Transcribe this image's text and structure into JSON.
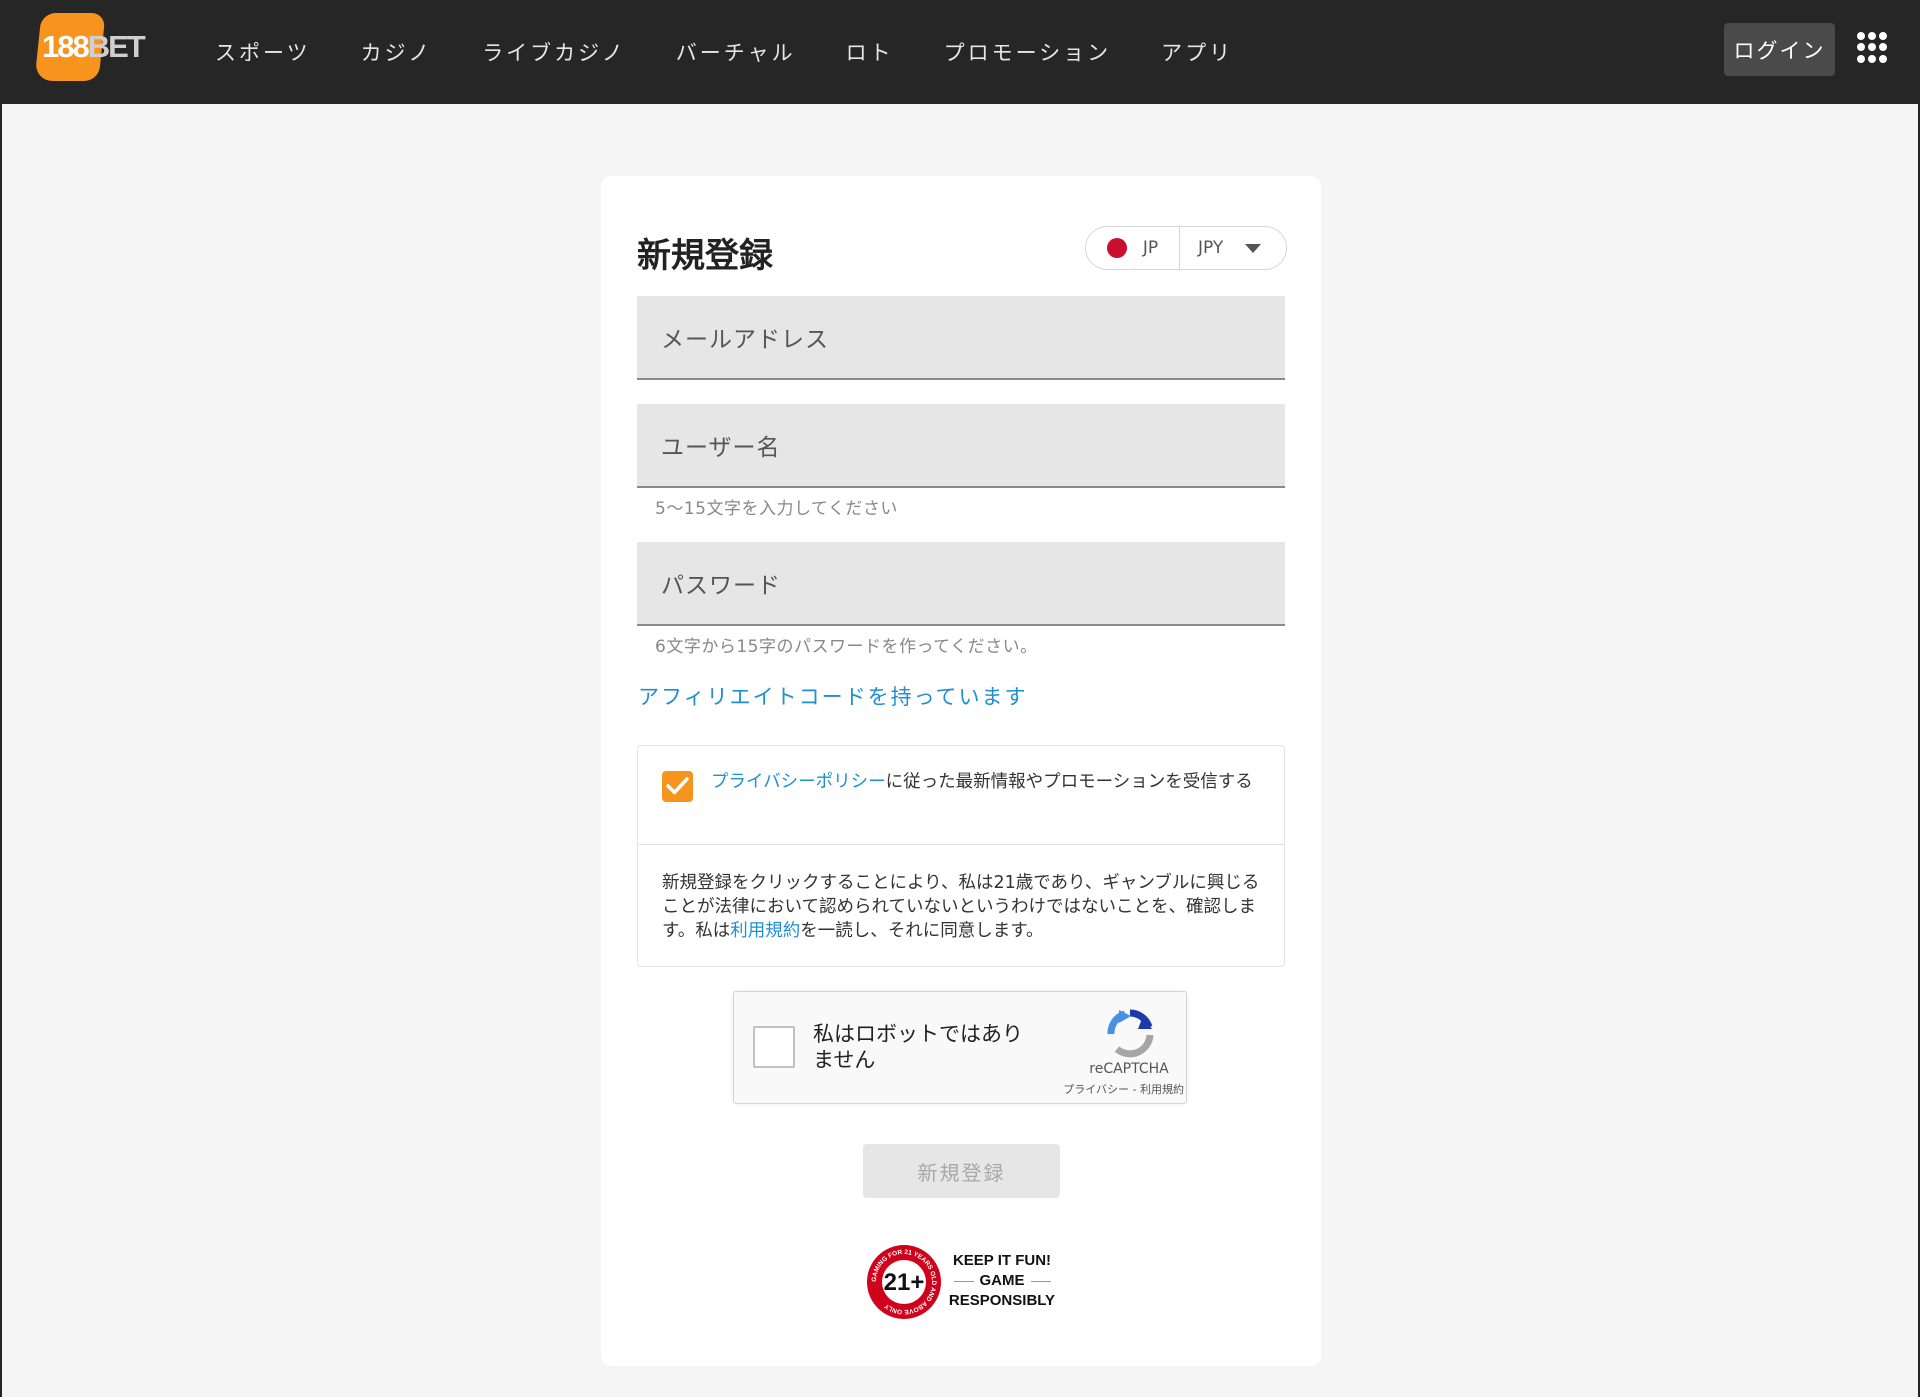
{
  "header": {
    "logo_number": "188",
    "logo_bet": "BET",
    "nav": [
      "スポーツ",
      "カジノ",
      "ライブカジノ",
      "バーチャル",
      "ロト",
      "プロモーション",
      "アプリ"
    ],
    "login_label": "ログイン"
  },
  "form": {
    "title": "新規登録",
    "country_code": "JP",
    "currency": "JPY",
    "email_placeholder": "メールアドレス",
    "username_placeholder": "ユーザー名",
    "username_hint": "5〜15文字を入力してください",
    "password_placeholder": "パスワード",
    "password_hint": "6文字から15字のパスワードを作ってください。",
    "affiliate_link": "アフィリエイトコードを持っています",
    "consent_link": "プライバシーポリシー",
    "consent_rest": "に従った最新情報やプロモーションを受信する",
    "consent_checked": true,
    "terms_before": "新規登録をクリックすることにより、私は21歳であり、ギャンブルに興じることが法律において認められていないというわけではないことを、確認します。私は",
    "terms_link": "利用規約",
    "terms_after": "を一読し、それに同意します。",
    "submit_label": "新規登録"
  },
  "recaptcha": {
    "label": "私はロボットではありません",
    "brand": "reCAPTCHA",
    "links": "プライバシー - 利用規約"
  },
  "responsible": {
    "badge_number": "21+",
    "badge_ring": "GAMING FOR 21 YEARS OLD AND ABOVE ONLY",
    "line1": "KEEP IT FUN!",
    "line2": "GAME",
    "line3": "RESPONSIBLY"
  },
  "colors": {
    "header_bg": "#262626",
    "accent_orange": "#f7941d",
    "link_blue": "#1e8fd0",
    "flag_red": "#c8102e",
    "badge_red": "#d0021b"
  }
}
